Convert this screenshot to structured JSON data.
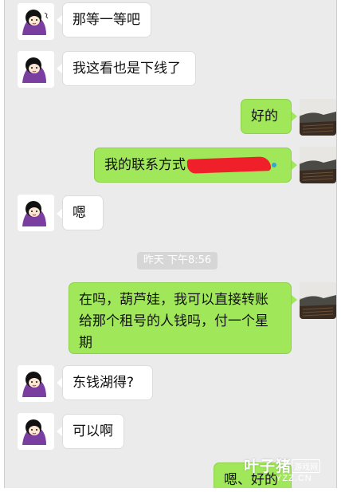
{
  "messages": [
    {
      "side": "in",
      "text": "那等一等吧"
    },
    {
      "side": "in",
      "text": "我这看也是下线了"
    },
    {
      "side": "out",
      "text": "好的"
    },
    {
      "side": "out",
      "text": "我的联系方式"
    },
    {
      "side": "in",
      "text": "嗯"
    },
    {
      "side": "out",
      "line1": "在吗，葫芦娃，我可以直接转账",
      "line2": "给那个租号的人钱吗，付一个星",
      "line3": "期"
    },
    {
      "side": "in",
      "text": "东钱湖得?"
    },
    {
      "side": "in",
      "text": "可以啊"
    },
    {
      "side": "out",
      "text": "嗯、好的"
    }
  ],
  "timestamp": "昨天 下午8:56",
  "watermark": {
    "brand": "叶子猪",
    "tag": "游戏网",
    "url": "YZZ.CN"
  },
  "colors": {
    "background": "#ebebeb",
    "outgoing": "#a0e75a",
    "incoming": "#ffffff",
    "redaction": "#f0202a"
  },
  "avatar_icons": {
    "incoming": "cartoon-girl-avatar",
    "outgoing": "pier-sunset-photo-avatar"
  }
}
